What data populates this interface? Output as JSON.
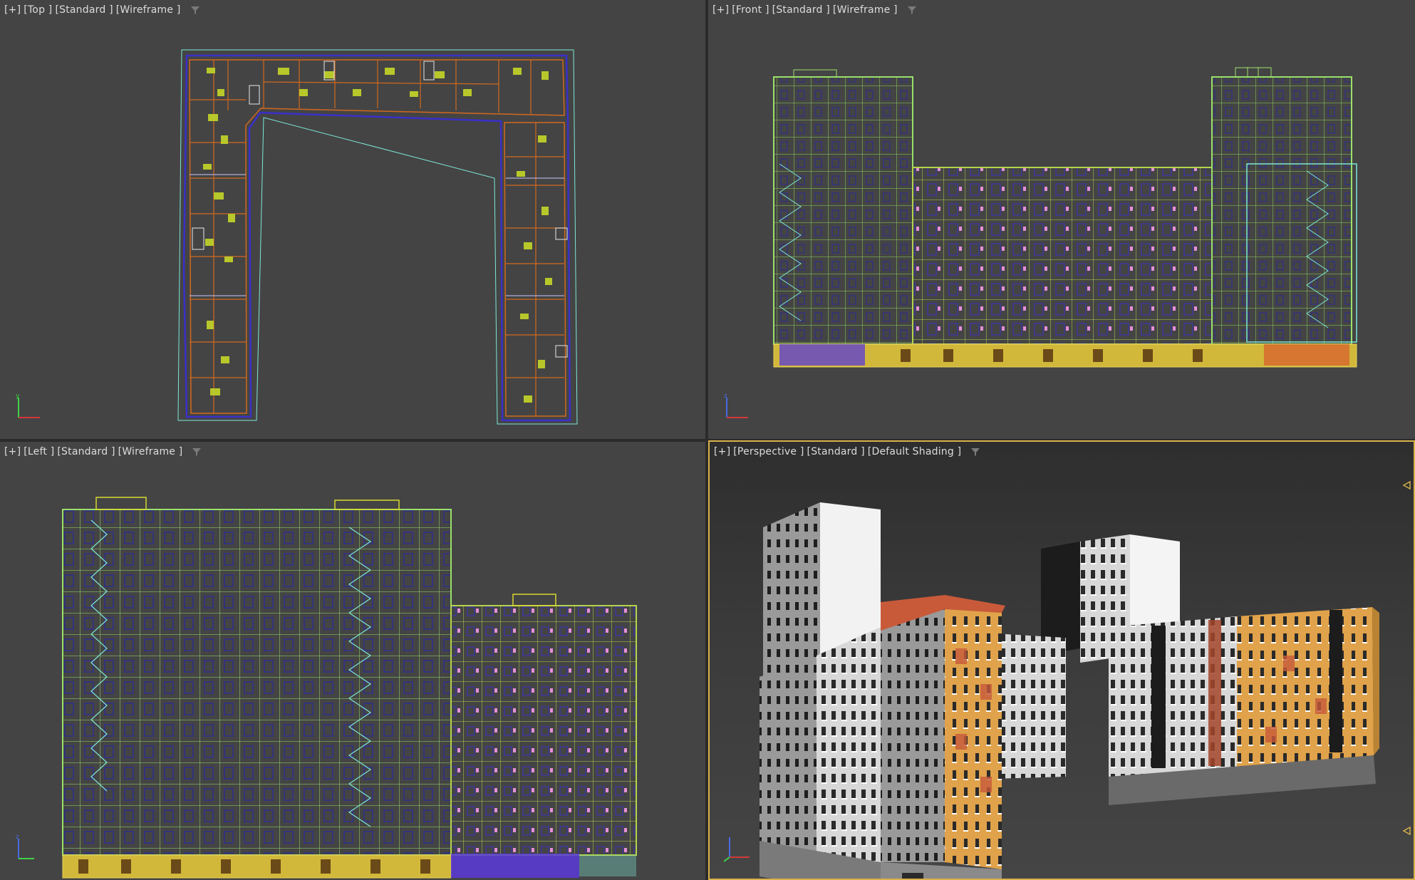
{
  "viewports": {
    "top": {
      "menu": "[+]",
      "view": "[Top ]",
      "shading": "[Standard ]",
      "mode": "[Wireframe ]"
    },
    "front": {
      "menu": "[+]",
      "view": "[Front ]",
      "shading": "[Standard ]",
      "mode": "[Wireframe ]"
    },
    "left": {
      "menu": "[+]",
      "view": "[Left ]",
      "shading": "[Standard ]",
      "mode": "[Wireframe ]"
    },
    "perspective": {
      "menu": "[+]",
      "view": "[Perspective ]",
      "shading": "[Standard ]",
      "mode": "[Default Shading ]",
      "active": true
    }
  },
  "icons": {
    "filter": "filter-icon",
    "axis": "axis-tripod-icon",
    "marker": "viewport-edge-marker-icon"
  },
  "colors": {
    "viewport_bg": "#444444",
    "active_border": "#d8b24a",
    "wire_green": "#9be06a",
    "wire_cyan": "#7de8d8",
    "wire_yellow": "#d8d830",
    "wire_orange": "#d2691e",
    "wire_blue": "#3a2fc8",
    "facade_orange": "#e0a24a",
    "facade_white": "#e6e6e6"
  }
}
